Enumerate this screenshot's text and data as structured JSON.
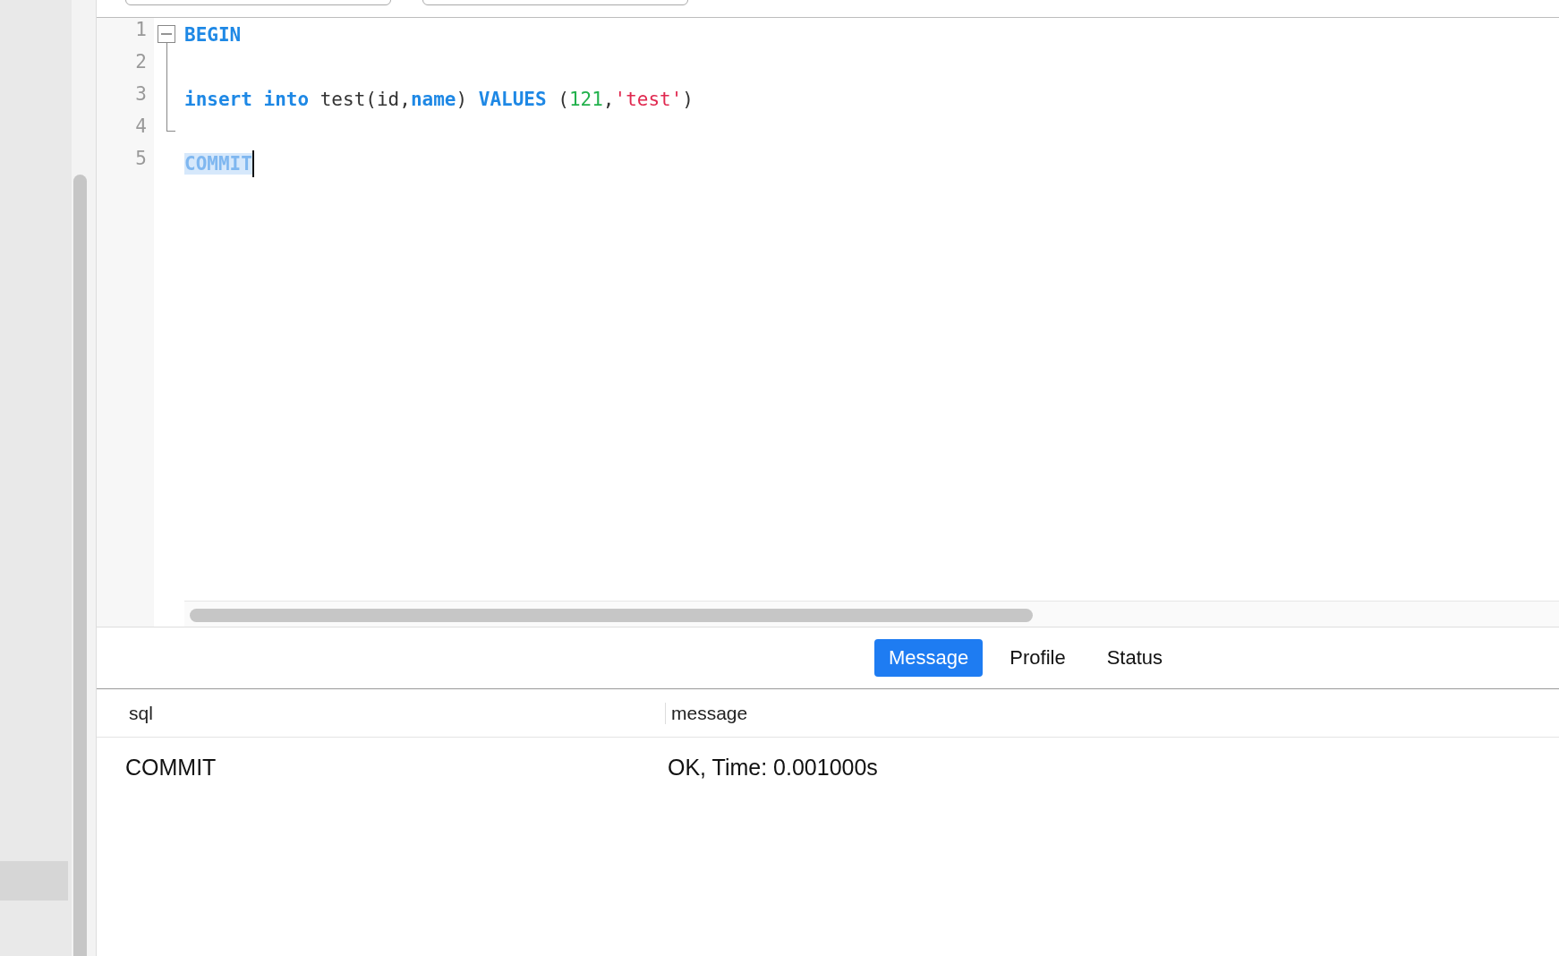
{
  "editor": {
    "lines": [
      {
        "number": "1",
        "kind": "fold_start",
        "expanded": true,
        "tokens": [
          {
            "text": "BEGIN",
            "kind": "keyword"
          }
        ]
      },
      {
        "number": "2",
        "kind": "fold_body"
      },
      {
        "number": "3",
        "kind": "fold_body",
        "tokens": [
          {
            "text": "insert",
            "kind": "keyword"
          },
          {
            "text": " into",
            "kind": "keyword"
          },
          {
            "text": " test(id,",
            "kind": "plain"
          },
          {
            "text": "name",
            "kind": "keyword"
          },
          {
            "text": ") ",
            "kind": "plain"
          },
          {
            "text": "VALUES",
            "kind": "keyword"
          },
          {
            "text": " (",
            "kind": "plain"
          },
          {
            "text": "121",
            "kind": "number"
          },
          {
            "text": ",",
            "kind": "plain"
          },
          {
            "text": "'test'",
            "kind": "string"
          },
          {
            "text": ")",
            "kind": "plain"
          }
        ]
      },
      {
        "number": "4",
        "kind": "fold_end"
      },
      {
        "number": "5",
        "kind": "plain",
        "cursor": true,
        "tokens": [
          {
            "text": "COMMIT",
            "kind": "keyword",
            "selected": true
          }
        ]
      }
    ]
  },
  "result_tabs": [
    {
      "label": "Message",
      "selected": true
    },
    {
      "label": "Profile",
      "selected": false
    },
    {
      "label": "Status",
      "selected": false
    }
  ],
  "table": {
    "columns": [
      "sql",
      "message"
    ],
    "rows": [
      [
        "COMMIT",
        "OK, Time: 0.001000s"
      ]
    ]
  }
}
